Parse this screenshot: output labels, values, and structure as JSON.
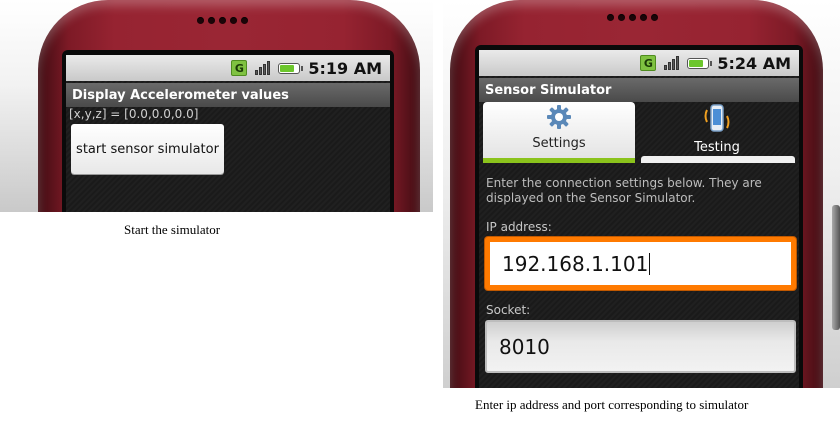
{
  "left": {
    "status": {
      "network": "G",
      "time": "5:19 AM"
    },
    "app_title": "Display Accelerometer values",
    "values_text": "[x,y,z] = [0.0,0.0,0.0]",
    "start_button": "start sensor simulator",
    "caption": "Start the simulator"
  },
  "right": {
    "status": {
      "network": "G",
      "time": "5:24 AM"
    },
    "app_title": "Sensor Simulator",
    "tabs": [
      {
        "label": "Settings",
        "icon": "gear-icon",
        "active": true
      },
      {
        "label": "Testing",
        "icon": "vibrating-phone-icon",
        "active": false
      }
    ],
    "instructions": "Enter the connection settings below. They are displayed on the Sensor Simulator.",
    "ip_label": "IP address:",
    "ip_value": "192.168.1.101",
    "socket_label": "Socket:",
    "socket_value": "8010",
    "caption": "Enter ip address and port corresponding to simulator"
  },
  "colors": {
    "phone_red": "#962331",
    "focus_orange": "#ff7a00",
    "tab_green": "#8bc31c"
  }
}
